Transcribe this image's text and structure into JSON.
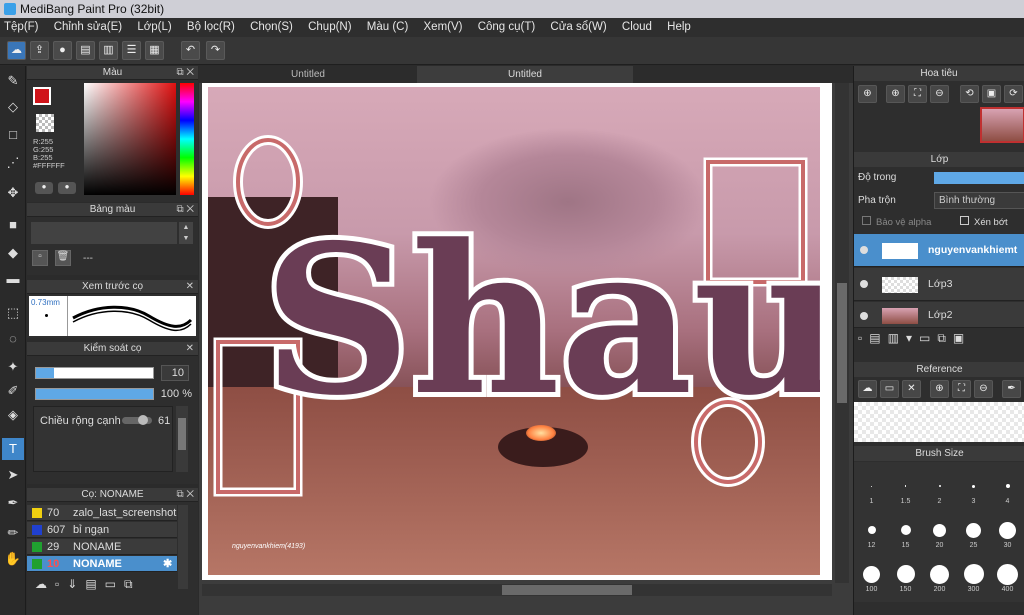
{
  "window": {
    "title": "MediBang Paint Pro (32bit)"
  },
  "menu": [
    "Tệp(F)",
    "Chỉnh sửa(E)",
    "Lớp(L)",
    "Bộ lọc(R)",
    "Chọn(S)",
    "Chụp(N)",
    "Màu (C)",
    "Xem(V)",
    "Công cụ(T)",
    "Cửa sổ(W)",
    "Cloud",
    "Help"
  ],
  "tabs": [
    "Untitled",
    "Untitled"
  ],
  "color_panel": {
    "title": "Màu",
    "r": "R:255",
    "g": "G:255",
    "b": "B:255",
    "hex": "#FFFFFF",
    "primary": "#d0141a"
  },
  "palette_panel": {
    "title": "Bảng màu",
    "placeholder": "---"
  },
  "brush_preview": {
    "title": "Xem trước cọ",
    "size": "0.73mm"
  },
  "brush_control": {
    "title": "Kiểm soát cọ",
    "size": "10",
    "opacity": "100 %",
    "edge_label": "Chiều rộng cạnh",
    "edge_value": "61",
    "size_fraction": 0.15,
    "opacity_fraction": 1.0
  },
  "brush_list": {
    "title": "Cọ: NONAME",
    "items": [
      {
        "num": "70",
        "name": "zalo_last_screenshot",
        "color": "#f0d010"
      },
      {
        "num": "607",
        "name": "bỉ ngạn",
        "color": "#2040d0"
      },
      {
        "num": "29",
        "name": "NONAME",
        "color": "#20a030"
      },
      {
        "num": "10",
        "name": "NONAME",
        "color": "#20a030"
      }
    ]
  },
  "navigator": {
    "title": "Hoa tiêu"
  },
  "layer_panel": {
    "title": "Lớp",
    "opacity_label": "Độ trong",
    "blend_label": "Pha trộn",
    "blend_value": "Bình thường",
    "protect_alpha": "Bảo vệ alpha",
    "clipping": "Xén bớt",
    "layers": [
      "nguyenvankhiemt",
      "Lớp3",
      "Lớp2"
    ]
  },
  "reference": {
    "title": "Reference"
  },
  "brush_size": {
    "title": "Brush Size",
    "sizes": [
      "1",
      "1.5",
      "2",
      "3",
      "4",
      "12",
      "15",
      "20",
      "25",
      "30",
      "100",
      "150",
      "200",
      "300",
      "400"
    ]
  },
  "artwork": {
    "text": "Shaul",
    "signature": "nguyenvankhiem(4193)"
  }
}
